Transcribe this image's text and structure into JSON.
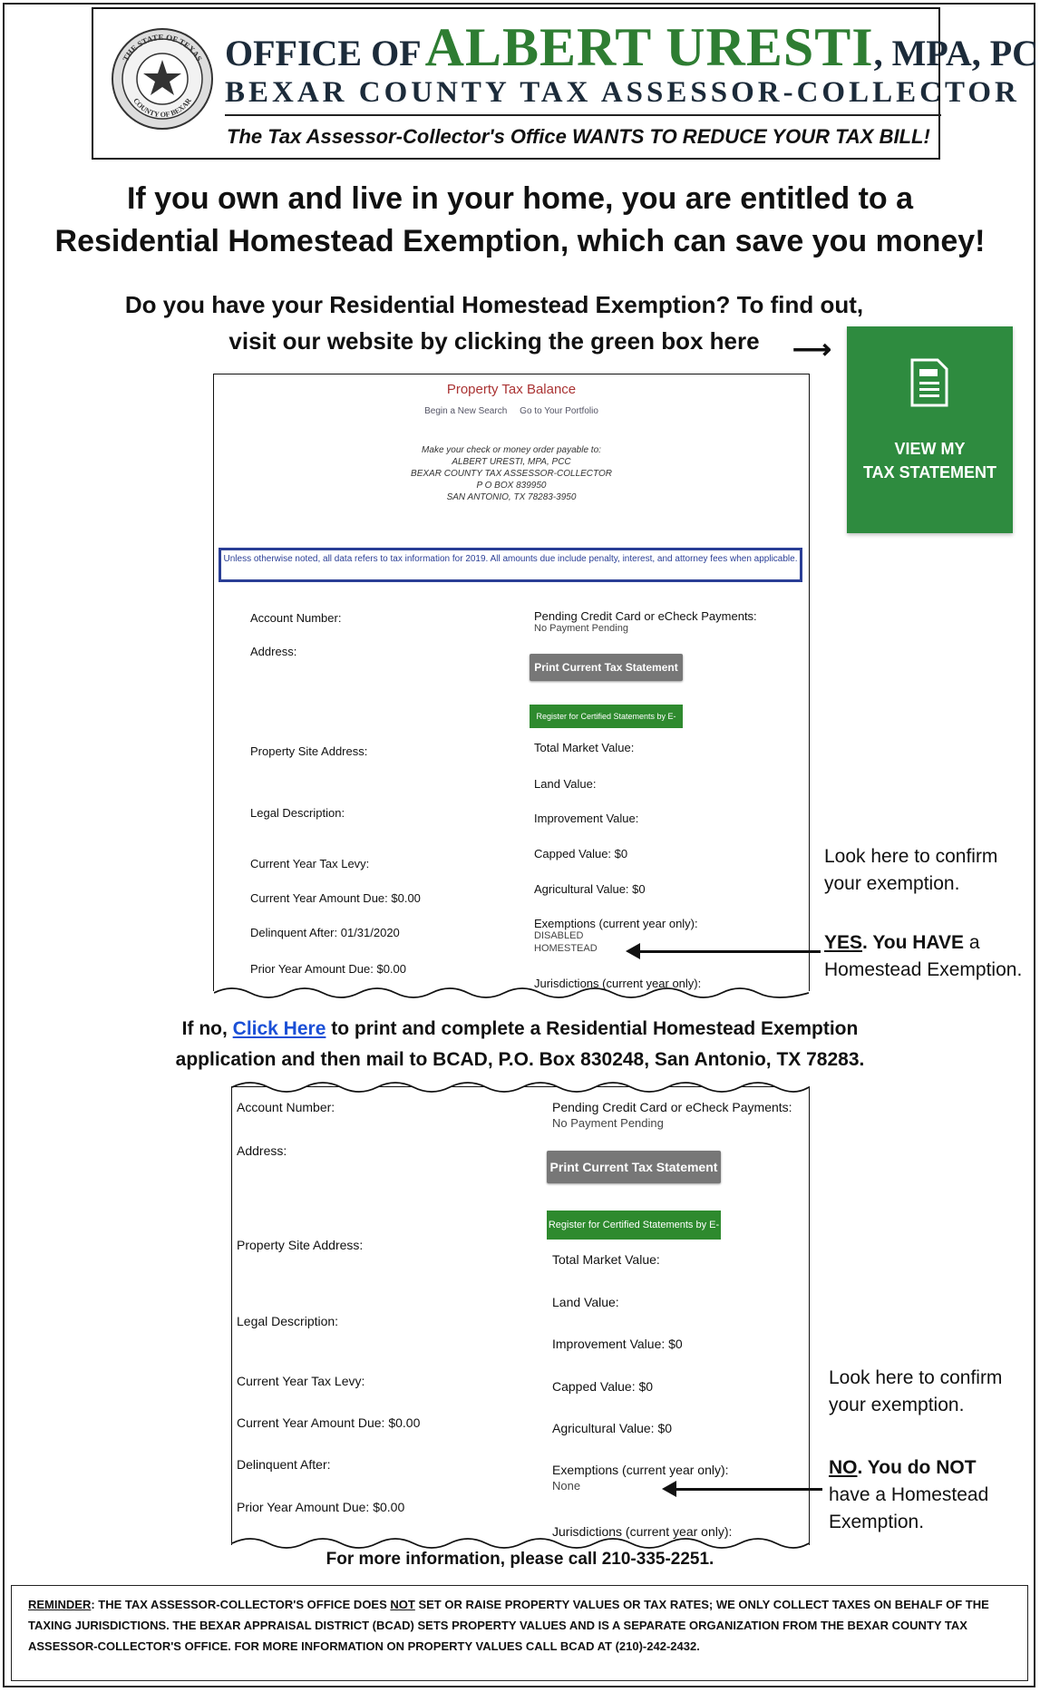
{
  "header": {
    "office_of": "OFFICE OF",
    "name": "ALBERT URESTI",
    "suffix": ", MPA, PCC",
    "county_title": "BEXAR COUNTY TAX ASSESSOR-COLLECTOR",
    "tagline": "The Tax Assessor-Collector's Office WANTS TO REDUCE YOUR TAX BILL!",
    "seal": {
      "top_text": "THE STATE OF TEXAS",
      "bottom_text": "COUNTY OF BEXAR"
    }
  },
  "headline": {
    "line1": "If you own and live in your home, you are entitled to a",
    "line2": "Residential Homestead Exemption, which can save you money!"
  },
  "question": {
    "line1": "Do you have your Residential Homestead Exemption?  To find out,",
    "line2": "visit our website by clicking the green box here"
  },
  "arrow_glyph": "⟶",
  "green_box": {
    "line1": "VIEW MY",
    "line2": "TAX STATEMENT",
    "icon": "document-icon",
    "color": "#2e8b3f"
  },
  "panel1": {
    "title": "Property Tax Balance",
    "links": [
      "Begin a New Search",
      "Go to Your Portfolio"
    ],
    "payable": [
      "Make your check or money order payable to:",
      "ALBERT URESTI, MPA, PCC",
      "BEXAR COUNTY TAX ASSESSOR-COLLECTOR",
      "P O BOX 839950",
      "SAN ANTONIO, TX 78283-3950"
    ],
    "notice": "Unless otherwise noted, all data refers to tax information for 2019. All amounts due include penalty, interest, and attorney fees when applicable.",
    "left": {
      "account": "Account Number:",
      "address": "Address:",
      "site": "Property Site Address:",
      "legal": "Legal Description:",
      "levy": "Current Year Tax Levy:",
      "amount_due": "Current Year Amount Due:  $0.00",
      "delinquent": "Delinquent After:  01/31/2020",
      "prior": "Prior Year Amount Due: $0.00"
    },
    "right": {
      "pending": "Pending Credit Card or eCheck Payments:",
      "pending_value": "No Payment Pending",
      "print_btn": "Print Current Tax Statement",
      "register_btn": "Register for Certified Statements by E-Mail",
      "market": "Total Market Value:",
      "land": "Land Value:",
      "improvement": "Improvement Value:",
      "capped": "Capped Value: $0",
      "agri": "Agricultural Value:   $0",
      "exemptions": "Exemptions (current year only):",
      "exemption_values": [
        "DISABLED",
        "HOMESTEAD"
      ],
      "jurisdictions": "Jurisdictions (current year only):"
    }
  },
  "callout1": {
    "look": [
      "Look here to confirm",
      "your exemption."
    ],
    "answer": "YES",
    "rest1": ". You HAVE",
    "rest2": " a",
    "rest3": "Homestead Exemption."
  },
  "ifno": {
    "prefix": "If no, ",
    "link": "Click Here",
    "rest1": " to print and complete a Residential Homestead Exemption",
    "line2": "application and then mail to BCAD, P.O. Box 830248, San Antonio, TX 78283."
  },
  "panel2": {
    "left": {
      "account": "Account Number:",
      "address": "Address:",
      "site": "Property Site Address:",
      "legal": "Legal Description:",
      "levy": "Current Year Tax Levy:",
      "amount_due": "Current Year Amount Due:  $0.00",
      "delinquent": "Delinquent After:",
      "prior": "Prior Year Amount Due: $0.00"
    },
    "right": {
      "pending": "Pending Credit Card or eCheck Payments:",
      "pending_value": "No Payment Pending",
      "print_btn": "Print Current Tax Statement",
      "register_btn": "Register for Certified Statements by E-Mail",
      "market": "Total Market Value:",
      "land": "Land Value:",
      "improvement": "Improvement Value:   $0",
      "capped": "Capped Value: $0",
      "agri": "Agricultural Value:   $0",
      "exemptions": "Exemptions (current year only):",
      "exemption_value": "None",
      "jurisdictions": "Jurisdictions (current year only):"
    }
  },
  "callout2": {
    "look": [
      "Look here to confirm",
      "your exemption."
    ],
    "answer": "NO",
    "rest1": ". You do NOT",
    "rest2": "have a Homestead",
    "rest3": "Exemption."
  },
  "more_info": "For more information, please call 210-335-2251.",
  "reminder": {
    "label": "REMINDER",
    "p1": ": THE TAX ASSESSOR-COLLECTOR'S OFFICE DOES ",
    "not": "NOT",
    "p2": " SET OR RAISE PROPERTY VALUES OR TAX RATES; WE ONLY COLLECT TAXES ON BEHALF OF THE TAXING JURISDICTIONS.  THE BEXAR APPRAISAL DISTRICT (BCAD) SETS PROPERTY VALUES AND IS A SEPARATE ORGANIZATION FROM THE BEXAR COUNTY TAX ASSESSOR-COLLECTOR'S OFFICE.  FOR MORE INFORMATION ON PROPERTY VALUES CALL BCAD AT (210)-242-2432."
  }
}
